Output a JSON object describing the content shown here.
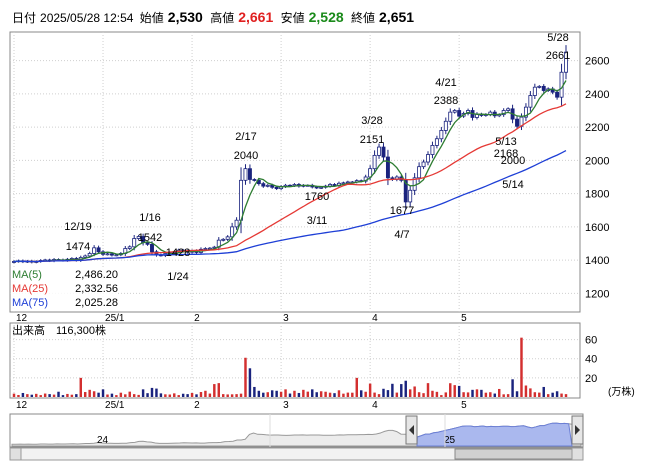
{
  "header": {
    "date_label": "日付",
    "date_value": "2025/05/28 12:54",
    "open_label": "始値",
    "open_value": "2,530",
    "high_label": "高値",
    "high_value": "2,661",
    "low_label": "安値",
    "low_value": "2,528",
    "close_label": "終値",
    "close_value": "2,651"
  },
  "legend": {
    "ma5_label": "MA(5)",
    "ma5_value": "2,486.20",
    "ma25_label": "MA(25)",
    "ma25_value": "2,332.56",
    "ma75_label": "MA(75)",
    "ma75_value": "2,025.28"
  },
  "volume_panel": {
    "title_label": "出来高",
    "title_value": "116,300株",
    "unit_label": "(万株)",
    "ticks": [
      "60",
      "40",
      "20"
    ]
  },
  "navigator": {
    "labels": [
      "24",
      "25"
    ]
  },
  "colors": {
    "up": "#ffffff",
    "down": "#1a237e",
    "ma5": "#2e7d32",
    "ma25": "#e53935",
    "ma75": "#1e3fd6",
    "grid": "#cfcfcf",
    "volume": "#1a237e",
    "volume_up": "#d32f2f",
    "nav_fill": "#aab8ee"
  },
  "chart_data": {
    "type": "candlestick",
    "price_axis": {
      "ticks": [
        1200,
        1400,
        1600,
        1800,
        2000,
        2200,
        2400,
        2600
      ],
      "ylim": [
        1100,
        2760
      ]
    },
    "x_tick_labels": [
      {
        "label": "12",
        "index": 0
      },
      {
        "label": "25/1",
        "index": 20
      },
      {
        "label": "2",
        "index": 40
      },
      {
        "label": "3",
        "index": 60
      },
      {
        "label": "4",
        "index": 80
      },
      {
        "label": "5",
        "index": 100
      }
    ],
    "annotations": [
      {
        "date": "12/19",
        "value": "1474"
      },
      {
        "date": "1/16",
        "value": "1542"
      },
      {
        "date": "1/24",
        "value": "1428"
      },
      {
        "date": "2/17",
        "value": "2040"
      },
      {
        "date": "3/11",
        "value": "1760"
      },
      {
        "date": "3/28",
        "value": "2151"
      },
      {
        "date": "4/7",
        "value": "1677"
      },
      {
        "date": "4/21",
        "value": "2388"
      },
      {
        "date": "5/13",
        "value": "2168"
      },
      {
        "date": "5/14",
        "value": "2000"
      },
      {
        "date": "5/28",
        "value": "2661"
      }
    ],
    "close": [
      1392,
      1396,
      1390,
      1394,
      1388,
      1392,
      1398,
      1401,
      1396,
      1404,
      1402,
      1398,
      1405,
      1410,
      1400,
      1416,
      1425,
      1440,
      1474,
      1450,
      1435,
      1438,
      1430,
      1432,
      1440,
      1470,
      1480,
      1530,
      1542,
      1505,
      1495,
      1450,
      1432,
      1428,
      1440,
      1445,
      1450,
      1460,
      1455,
      1448,
      1456,
      1446,
      1465,
      1470,
      1472,
      1478,
      1520,
      1525,
      1540,
      1600,
      1640,
      1880,
      1950,
      1885,
      1880,
      1860,
      1845,
      1850,
      1838,
      1830,
      1842,
      1850,
      1848,
      1855,
      1845,
      1850,
      1850,
      1840,
      1835,
      1838,
      1845,
      1855,
      1848,
      1862,
      1865,
      1870,
      1870,
      1878,
      1875,
      1900,
      1950,
      2030,
      2080,
      2020,
      1895,
      1885,
      1900,
      1880,
      1750,
      1820,
      1895,
      1962,
      1990,
      2035,
      2090,
      2130,
      2180,
      2235,
      2290,
      2300,
      2266,
      2282,
      2300,
      2258,
      2278,
      2270,
      2276,
      2290,
      2268,
      2275,
      2300,
      2310,
      2248,
      2205,
      2260,
      2320,
      2390,
      2440,
      2445,
      2420,
      2430,
      2410,
      2380,
      2530,
      2651
    ],
    "ma5_last": 2486.2,
    "ma25_last": 2332.56,
    "ma75_last": 2025.28,
    "volume": [
      3.5,
      2.1,
      4.2,
      3.0,
      2.4,
      3.3,
      2.0,
      3.6,
      3.0,
      2.5,
      5.5,
      2.0,
      3.2,
      2.4,
      3.0,
      20.0,
      5.2,
      7.5,
      6.0,
      4.5,
      8.0,
      2.6,
      3.5,
      2.0,
      4.5,
      2.8,
      5.6,
      3.0,
      2.2,
      8.0,
      4.0,
      9.5,
      8.8,
      3.8,
      2.8,
      2.6,
      3.8,
      2.0,
      3.4,
      3.0,
      4.2,
      2.8,
      5.2,
      6.5,
      3.6,
      13.5,
      14.5,
      3.0,
      2.7,
      2.8,
      3.0,
      3.5,
      41.0,
      30.0,
      10.5,
      6.5,
      4.5,
      5.0,
      7.0,
      6.5,
      5.5,
      8.0,
      3.6,
      6.5,
      4.2,
      7.5,
      5.6,
      8.0,
      5.0,
      6.0,
      5.5,
      4.5,
      4.0,
      7.0,
      3.5,
      4.6,
      4.5,
      20.0,
      7.0,
      5.5,
      14.0,
      4.6,
      3.0,
      8.6,
      7.2,
      13.8,
      4.6,
      13.5,
      17.0,
      8.0,
      11.0,
      5.0,
      4.0,
      14.5,
      6.5,
      5.4,
      2.0,
      4.8,
      14.4,
      12.4,
      11.6,
      5.0,
      4.8,
      7.5,
      8.0,
      7.5,
      4.5,
      5.0,
      3.6,
      8.4,
      2.8,
      3.0,
      18.5,
      6.0,
      62.0,
      12.0,
      9.0,
      5.0,
      4.6,
      10.5,
      3.0,
      4.5,
      6.0,
      3.6,
      3.0
    ],
    "volume_ylim": [
      0,
      70
    ],
    "volume_unit": "万株"
  }
}
